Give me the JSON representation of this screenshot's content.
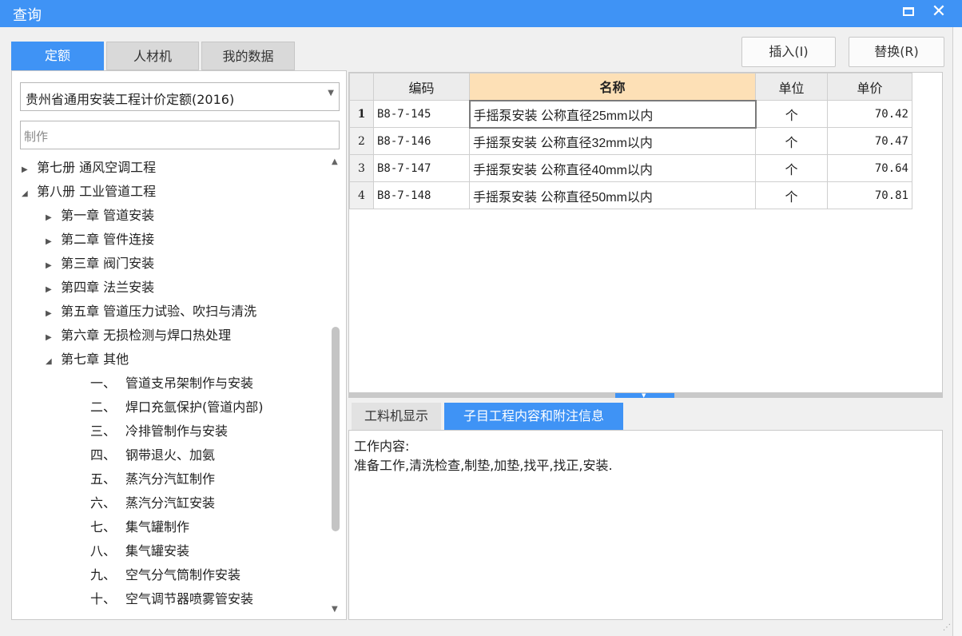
{
  "window": {
    "title": "查询"
  },
  "tabs": [
    {
      "label": "定额"
    },
    {
      "label": "人材机"
    },
    {
      "label": "我的数据"
    }
  ],
  "actions": {
    "insert_label": "插入(I)",
    "replace_label": "替换(R)"
  },
  "quota_library": {
    "selected": "贵州省通用安装工程计价定额(2016)"
  },
  "search": {
    "value": "制作"
  },
  "tree": [
    {
      "level": 0,
      "toggle": "▶",
      "text": "第七册 通风空调工程"
    },
    {
      "level": 0,
      "toggle": "◢",
      "text": "第八册 工业管道工程"
    },
    {
      "level": 1,
      "toggle": "▶",
      "text": "第一章 管道安装"
    },
    {
      "level": 1,
      "toggle": "▶",
      "text": "第二章 管件连接"
    },
    {
      "level": 1,
      "toggle": "▶",
      "text": "第三章 阀门安装"
    },
    {
      "level": 1,
      "toggle": "▶",
      "text": "第四章 法兰安装"
    },
    {
      "level": 1,
      "toggle": "▶",
      "text": "第五章 管道压力试验、吹扫与清洗"
    },
    {
      "level": 1,
      "toggle": "▶",
      "text": "第六章 无损检测与焊口热处理"
    },
    {
      "level": 1,
      "toggle": "◢",
      "text": "第七章 其他"
    },
    {
      "level": 2,
      "num": "一、",
      "text": "管道支吊架制作与安装"
    },
    {
      "level": 2,
      "num": "二、",
      "text": "焊口充氩保护(管道内部)"
    },
    {
      "level": 2,
      "num": "三、",
      "text": "冷排管制作与安装"
    },
    {
      "level": 2,
      "num": "四、",
      "text": "钢带退火、加氨"
    },
    {
      "level": 2,
      "num": "五、",
      "text": "蒸汽分汽缸制作"
    },
    {
      "level": 2,
      "num": "六、",
      "text": "蒸汽分汽缸安装"
    },
    {
      "level": 2,
      "num": "七、",
      "text": "集气罐制作"
    },
    {
      "level": 2,
      "num": "八、",
      "text": "集气罐安装"
    },
    {
      "level": 2,
      "num": "九、",
      "text": "空气分气筒制作安装"
    },
    {
      "level": 2,
      "num": "十、",
      "text": "空气调节器喷雾管安装"
    }
  ],
  "grid": {
    "columns": [
      "编码",
      "名称",
      "单位",
      "单价"
    ],
    "rows": [
      {
        "no": "1",
        "code": "B8-7-145",
        "name": "手摇泵安装 公称直径25mm以内",
        "unit": "个",
        "price": "70.42"
      },
      {
        "no": "2",
        "code": "B8-7-146",
        "name": "手摇泵安装 公称直径32mm以内",
        "unit": "个",
        "price": "70.47"
      },
      {
        "no": "3",
        "code": "B8-7-147",
        "name": "手摇泵安装 公称直径40mm以内",
        "unit": "个",
        "price": "70.64"
      },
      {
        "no": "4",
        "code": "B8-7-148",
        "name": "手摇泵安装 公称直径50mm以内",
        "unit": "个",
        "price": "70.81"
      }
    ]
  },
  "detail_tabs": [
    {
      "label": "工料机显示"
    },
    {
      "label": "子目工程内容和附注信息"
    }
  ],
  "detail": {
    "heading": "工作内容:",
    "content": "准备工作,清洗检查,制垫,加垫,找平,找正,安装."
  },
  "colors": {
    "accent": "#3f93f5",
    "header_highlight": "#fde0b6"
  }
}
